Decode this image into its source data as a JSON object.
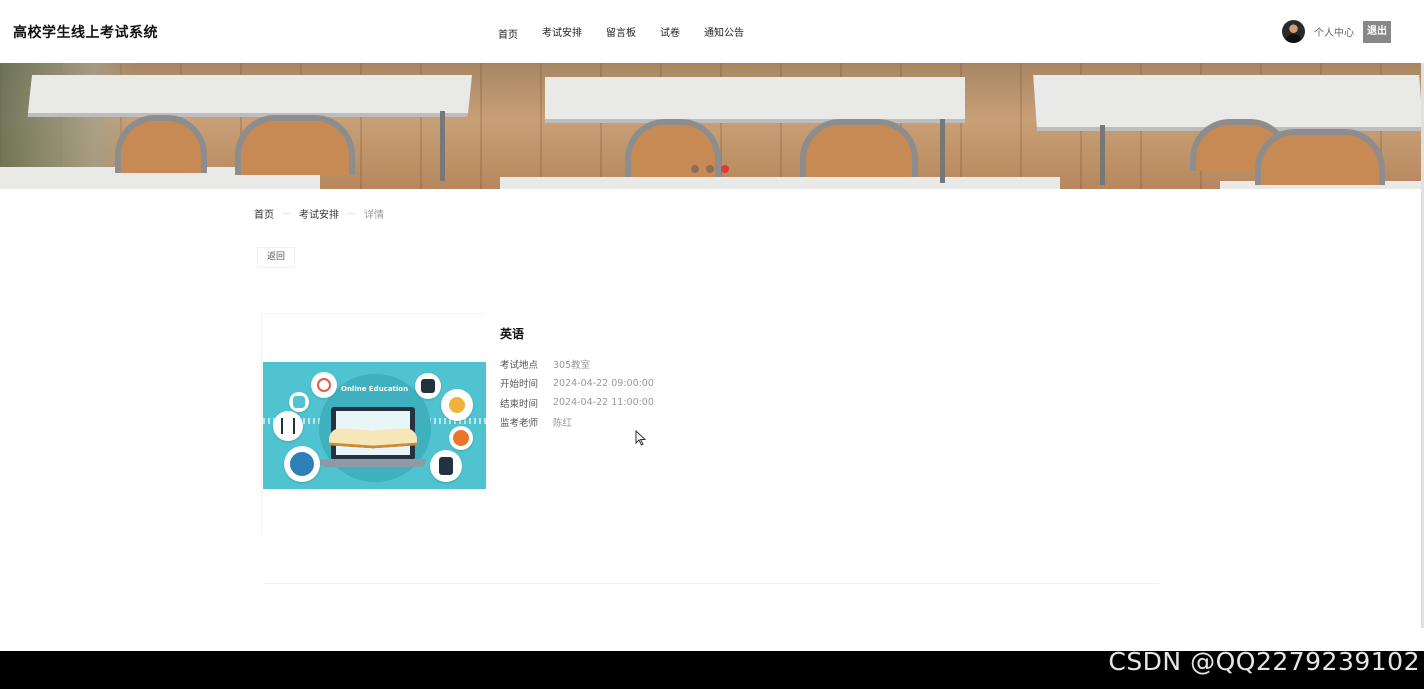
{
  "site": {
    "title": "高校学生线上考试系统"
  },
  "nav": {
    "items": [
      "首页",
      "考试安排",
      "留言板",
      "试卷",
      "通知公告"
    ]
  },
  "user": {
    "center_label": "个人中心",
    "logout_label": "退出"
  },
  "banner": {
    "slide_count": 3,
    "active_slide": 3
  },
  "breadcrumb": {
    "home": "首页",
    "section": "考试安排",
    "current": "详情"
  },
  "detail": {
    "back_label": "返回",
    "image_caption": "Online Education",
    "name": "英语",
    "fields": [
      {
        "label": "考试地点",
        "value": "305教室"
      },
      {
        "label": "开始时间",
        "value": "2024-04-22 09:00:00"
      },
      {
        "label": "结束时间",
        "value": "2024-04-22 11:00:00"
      },
      {
        "label": "监考老师",
        "value": "陈红"
      }
    ]
  },
  "watermark": {
    "text": "CSDN @QQ2279239102"
  },
  "colors": {
    "logout_bg": "#888888",
    "active_dot": "#e03a3a",
    "thumb_bg": "#4fc3cf",
    "footer_bg": "#000000"
  }
}
